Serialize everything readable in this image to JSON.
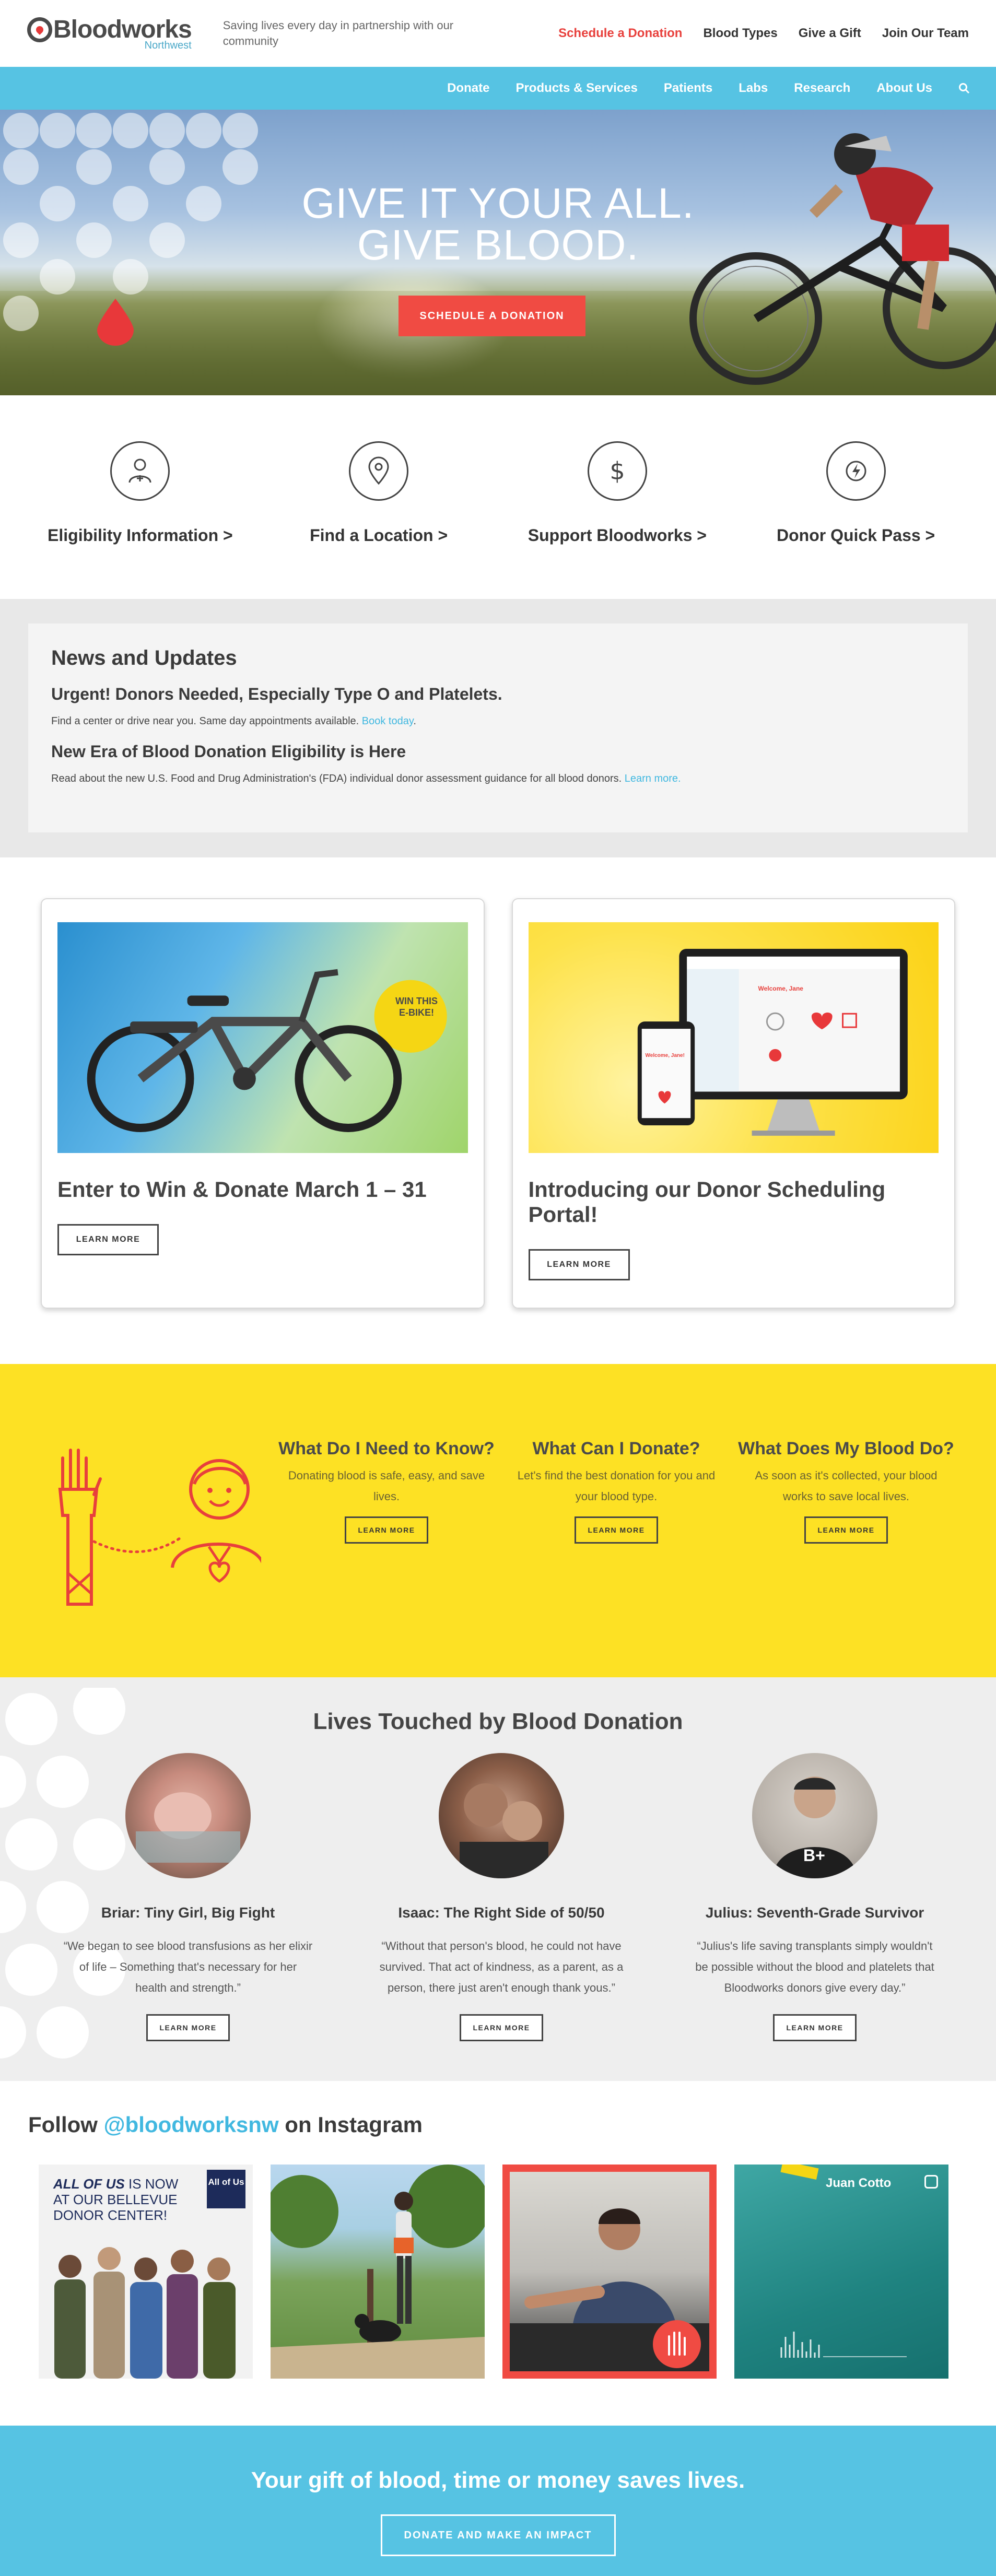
{
  "header": {
    "logo_text": "Bloodworks",
    "logo_sub": "Northwest",
    "tagline": "Saving lives every day in partnership with our community",
    "top_links": [
      "Schedule a Donation",
      "Blood Types",
      "Give a Gift",
      "Join Our Team"
    ]
  },
  "nav": {
    "items": [
      "Donate",
      "Products & Services",
      "Patients",
      "Labs",
      "Research",
      "About Us"
    ]
  },
  "hero": {
    "line1": "GIVE IT YOUR ALL.",
    "line2": "GIVE BLOOD.",
    "cta": "SCHEDULE A DONATION"
  },
  "quick_links": [
    {
      "label": "Eligibility Information >",
      "icon": "person-plus-icon"
    },
    {
      "label": "Find a Location >",
      "icon": "map-pin-icon"
    },
    {
      "label": "Support Bloodworks >",
      "icon": "dollar-icon"
    },
    {
      "label": "Donor Quick Pass >",
      "icon": "lightning-icon"
    }
  ],
  "news": {
    "title": "News and Updates",
    "items": [
      {
        "headline": "Urgent! Donors Needed, Especially Type O and Platelets.",
        "body": "Find a center or drive near you. Same day appointments available.",
        "link": "Book today",
        "after": "."
      },
      {
        "headline": "New Era of Blood Donation Eligibility is Here",
        "body": "Read about the new U.S. Food and Drug Administration's (FDA) individual donor assessment guidance for all blood donors.",
        "link": "Learn more.",
        "after": ""
      }
    ]
  },
  "cards": [
    {
      "title": "Enter to Win & Donate March 1 – 31",
      "button": "LEARN MORE",
      "badge": "WIN THIS E-BIKE!"
    },
    {
      "title": "Introducing our Donor Scheduling Portal!",
      "button": "LEARN MORE",
      "screen_title": "Welcome, Jane",
      "phone_title": "Welcome, Jane!"
    }
  ],
  "info_columns": [
    {
      "title": "What Do I Need to Know?",
      "body": "Donating blood is safe, easy, and save lives.",
      "button": "LEARN MORE"
    },
    {
      "title": "What Can I Donate?",
      "body": "Let's find the best donation for you and your blood type.",
      "button": "LEARN MORE"
    },
    {
      "title": "What Does My Blood Do?",
      "body": "As soon as it's collected, your blood works to save local lives.",
      "button": "LEARN MORE"
    }
  ],
  "lives": {
    "title": "Lives Touched by Blood Donation",
    "people": [
      {
        "name": "Briar: Tiny Girl, Big Fight",
        "quote": "“We began to see blood transfusions as her elixir of life – Something that's necessary for her health and strength.”",
        "button": "LEARN MORE"
      },
      {
        "name": "Isaac: The Right Side of 50/50",
        "quote": "“Without that person's blood, he could not have survived. That act of kindness, as a parent, as a person, there just aren't enough thank yous.”",
        "button": "LEARN MORE"
      },
      {
        "name": "Julius: Seventh-Grade Survivor",
        "quote": "“Julius's life saving transplants simply wouldn't be possible without the blood and platelets that Bloodworks donors give every day.”",
        "button": "LEARN MORE",
        "shirt": "B+"
      }
    ]
  },
  "instagram": {
    "prefix": "Follow ",
    "handle": "@bloodworksnw",
    "suffix": " on Instagram",
    "post1_line1": "ALL OF US",
    "post1_line1b": " IS NOW",
    "post1_line2": "AT OUR BELLEVUE",
    "post1_line3": "DONOR CENTER!",
    "post1_badge": "All of Us",
    "post4_name": "Juan Cotto"
  },
  "footer": {
    "headline": "Your gift of blood, time or money saves lives.",
    "button": "DONATE AND MAKE AN IMPACT"
  },
  "colors": {
    "accent_blue": "#56c3e3",
    "accent_red": "#f04b43",
    "yellow": "#fde124"
  }
}
